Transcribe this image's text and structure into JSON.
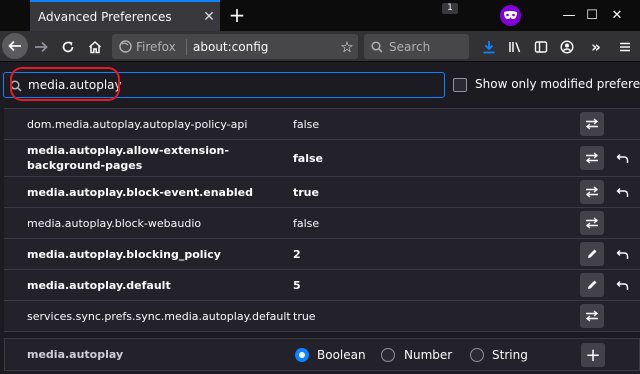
{
  "browser": {
    "tab_title": "Advanced Preferences",
    "tab_counter": "1",
    "url_identity": "Firefox",
    "url": "about:config",
    "search_placeholder": "Search",
    "accent_color": "#0a84ff",
    "private_color": "#8000d7"
  },
  "config": {
    "filter_value": "media.autoplay",
    "show_modified_label": "Show only modified preferences",
    "show_modified_checked": false,
    "annotation_color": "#e41b23",
    "prefs": [
      {
        "name": "dom.media.autoplay.autoplay-policy-api",
        "value": "false",
        "modified": false,
        "action": "toggle-icon"
      },
      {
        "name": "media.autoplay.allow-extension-background-pages",
        "value": "false",
        "modified": true,
        "action": "toggle-icon"
      },
      {
        "name": "media.autoplay.block-event.enabled",
        "value": "true",
        "modified": true,
        "action": "toggle-icon"
      },
      {
        "name": "media.autoplay.block-webaudio",
        "value": "false",
        "modified": false,
        "action": "toggle-icon"
      },
      {
        "name": "media.autoplay.blocking_policy",
        "value": "2",
        "modified": true,
        "action": "edit-icon"
      },
      {
        "name": "media.autoplay.default",
        "value": "5",
        "modified": true,
        "action": "edit-icon"
      },
      {
        "name": "services.sync.prefs.sync.media.autoplay.default",
        "value": "true",
        "modified": false,
        "action": "toggle-icon"
      }
    ],
    "add_row": {
      "name": "media.autoplay",
      "types": [
        "Boolean",
        "Number",
        "String"
      ],
      "selected_type": "Boolean"
    }
  }
}
